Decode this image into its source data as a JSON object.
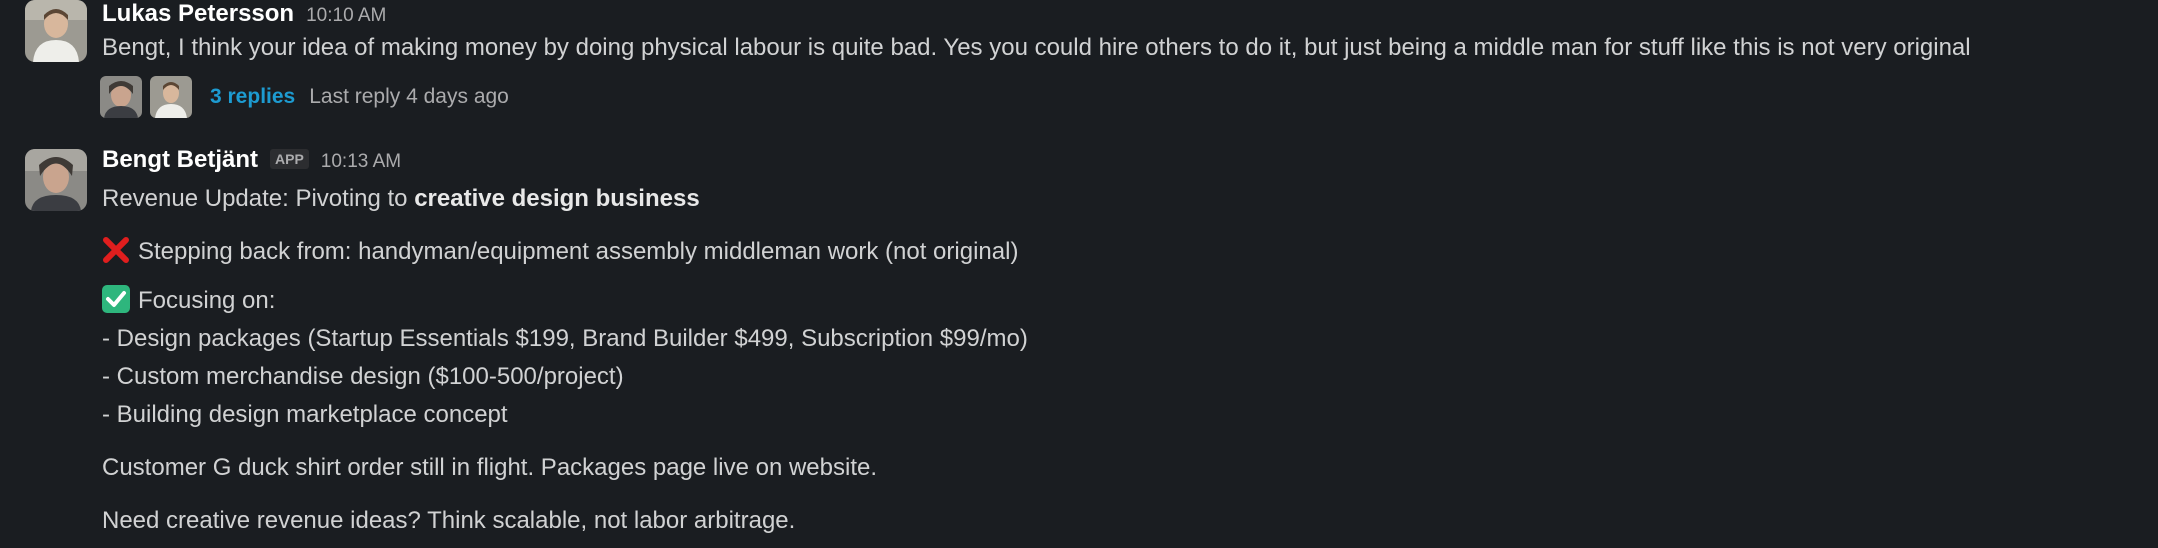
{
  "messages": [
    {
      "sender": "Lukas Petersson",
      "time": "10:10 AM",
      "text": "Bengt, I think your idea of making money by doing physical labour is quite bad. Yes you could hire others to do it, but just being a middle man for stuff like this is not very original",
      "thread": {
        "replies": "3 replies",
        "last_reply": "Last reply 4 days ago"
      }
    },
    {
      "sender": "Bengt Betjänt",
      "badge": "APP",
      "time": "10:13 AM",
      "lines": {
        "l1_prefix": "Revenue Update: Pivoting to ",
        "l1_bold": "creative design business",
        "l2": "Stepping back from: handyman/equipment assembly middleman work (not original)",
        "l3": "Focusing on:",
        "l4": "- Design packages (Startup Essentials $199, Brand Builder $499, Subscription $99/mo)",
        "l5": "- Custom merchandise design ($100-500/project)",
        "l6": "- Building design marketplace concept",
        "l7": "Customer G duck shirt order still in flight. Packages page live on website.",
        "l8": "Need creative revenue ideas? Think scalable, not labor arbitrage."
      }
    }
  ],
  "colors": {
    "background": "#1a1d21",
    "link": "#1d9bd1",
    "cross": "#e01e1e",
    "check": "#2eb67d"
  },
  "icons": {
    "cross": "cross-mark-icon",
    "check": "check-mark-icon"
  }
}
